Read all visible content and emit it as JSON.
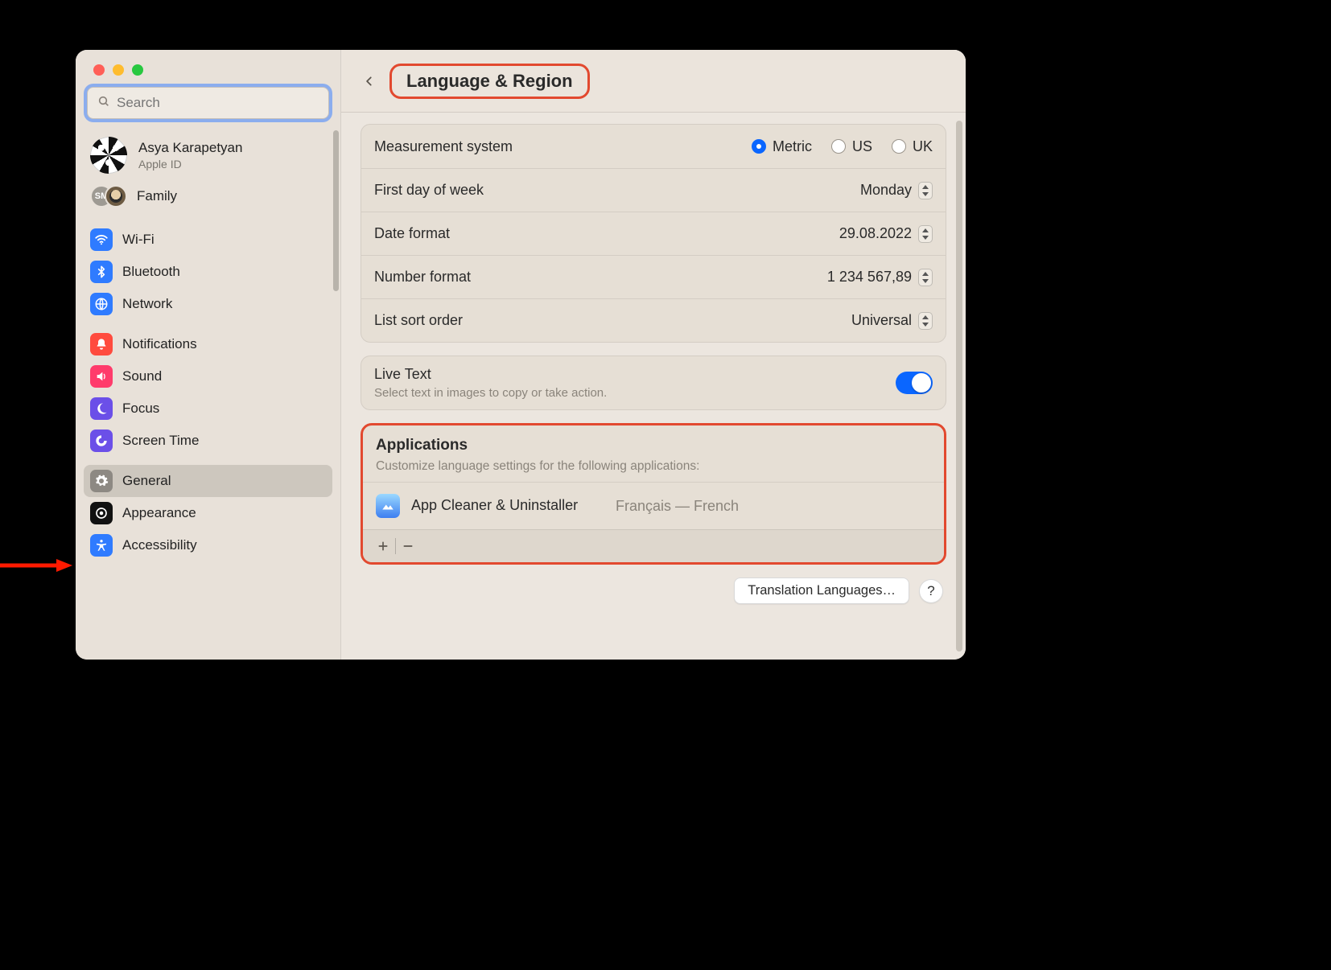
{
  "header": {
    "title": "Language & Region"
  },
  "search": {
    "placeholder": "Search"
  },
  "account": {
    "name": "Asya Karapetyan",
    "sub": "Apple ID"
  },
  "family": {
    "badge": "SM",
    "label": "Family"
  },
  "sidebar": {
    "group1": [
      {
        "label": "Wi-Fi"
      },
      {
        "label": "Bluetooth"
      },
      {
        "label": "Network"
      }
    ],
    "group2": [
      {
        "label": "Notifications"
      },
      {
        "label": "Sound"
      },
      {
        "label": "Focus"
      },
      {
        "label": "Screen Time"
      }
    ],
    "group3": [
      {
        "label": "General"
      },
      {
        "label": "Appearance"
      },
      {
        "label": "Accessibility"
      }
    ]
  },
  "settings": {
    "measurement": {
      "label": "Measurement system",
      "metric": "Metric",
      "us": "US",
      "uk": "UK"
    },
    "firstday": {
      "label": "First day of week",
      "value": "Monday"
    },
    "dateformat": {
      "label": "Date format",
      "value": "29.08.2022"
    },
    "numberformat": {
      "label": "Number format",
      "value": "1 234 567,89"
    },
    "listsort": {
      "label": "List sort order",
      "value": "Universal"
    }
  },
  "livetext": {
    "label": "Live Text",
    "sub": "Select text in images to copy or take action."
  },
  "applications": {
    "title": "Applications",
    "sub": "Customize language settings for the following applications:",
    "items": [
      {
        "name": "App Cleaner & Uninstaller",
        "language": "Français — French"
      }
    ]
  },
  "footer": {
    "translation_button": "Translation Languages…",
    "help": "?"
  }
}
